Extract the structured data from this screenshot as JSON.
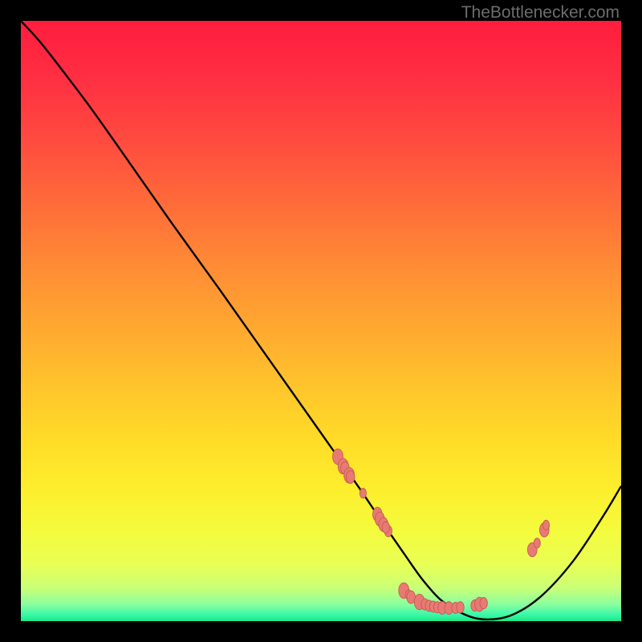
{
  "watermark": "TheBottlenecker.com",
  "gradient_stops": [
    {
      "offset": 0.0,
      "color": "#ff1d3e"
    },
    {
      "offset": 0.1,
      "color": "#ff3042"
    },
    {
      "offset": 0.2,
      "color": "#ff4b3f"
    },
    {
      "offset": 0.3,
      "color": "#ff6a3a"
    },
    {
      "offset": 0.4,
      "color": "#ff8935"
    },
    {
      "offset": 0.5,
      "color": "#ffa531"
    },
    {
      "offset": 0.6,
      "color": "#ffc22c"
    },
    {
      "offset": 0.7,
      "color": "#ffdc28"
    },
    {
      "offset": 0.78,
      "color": "#fdee2c"
    },
    {
      "offset": 0.85,
      "color": "#f4fb3d"
    },
    {
      "offset": 0.905,
      "color": "#e9ff54"
    },
    {
      "offset": 0.945,
      "color": "#c9ff77"
    },
    {
      "offset": 0.972,
      "color": "#8bff9f"
    },
    {
      "offset": 0.99,
      "color": "#37f7a8"
    },
    {
      "offset": 1.0,
      "color": "#1be784"
    }
  ],
  "marker_fill": "#e77b73",
  "marker_stroke": "#c85a52",
  "chart_data": {
    "type": "line",
    "title": "",
    "xlabel": "",
    "ylabel": "",
    "xlim": [
      0,
      100
    ],
    "ylim": [
      0,
      100
    ],
    "series": [
      {
        "name": "bottleneck-curve",
        "x": [
          0.0,
          3.2,
          7.5,
          12.0,
          18.0,
          25.0,
          33.0,
          40.0,
          46.0,
          52.0,
          56.5,
          60.0,
          64.0,
          67.0,
          70.0,
          73.5,
          77.0,
          81.5,
          86.5,
          92.0,
          97.0,
          100.0
        ],
        "y": [
          100.0,
          96.5,
          91.0,
          85.0,
          76.5,
          66.5,
          55.4,
          45.5,
          37.0,
          28.5,
          22.0,
          16.8,
          11.0,
          6.8,
          3.5,
          1.3,
          0.3,
          0.9,
          4.0,
          10.0,
          17.5,
          22.5
        ]
      }
    ],
    "markers": [
      {
        "x": 52.8,
        "y": 27.4,
        "r": 1.1
      },
      {
        "x": 53.7,
        "y": 25.8,
        "r": 1.1
      },
      {
        "x": 54.0,
        "y": 25.5,
        "r": 0.9
      },
      {
        "x": 54.7,
        "y": 24.3,
        "r": 1.1
      },
      {
        "x": 54.9,
        "y": 24.0,
        "r": 0.9
      },
      {
        "x": 57.0,
        "y": 21.3,
        "r": 0.7
      },
      {
        "x": 59.4,
        "y": 17.8,
        "r": 1.0
      },
      {
        "x": 59.8,
        "y": 17.0,
        "r": 1.0
      },
      {
        "x": 60.4,
        "y": 16.1,
        "r": 1.0
      },
      {
        "x": 61.2,
        "y": 15.0,
        "r": 0.8
      },
      {
        "x": 60.8,
        "y": 15.6,
        "r": 0.8
      },
      {
        "x": 63.8,
        "y": 5.1,
        "r": 1.1
      },
      {
        "x": 64.6,
        "y": 4.4,
        "r": 0.7
      },
      {
        "x": 65.0,
        "y": 4.0,
        "r": 0.9
      },
      {
        "x": 66.4,
        "y": 3.2,
        "r": 1.1
      },
      {
        "x": 67.3,
        "y": 2.8,
        "r": 0.8
      },
      {
        "x": 68.0,
        "y": 2.55,
        "r": 0.8
      },
      {
        "x": 68.7,
        "y": 2.4,
        "r": 0.8
      },
      {
        "x": 69.4,
        "y": 2.3,
        "r": 0.8
      },
      {
        "x": 70.2,
        "y": 2.2,
        "r": 0.9
      },
      {
        "x": 71.3,
        "y": 2.18,
        "r": 0.9
      },
      {
        "x": 72.4,
        "y": 2.2,
        "r": 0.8
      },
      {
        "x": 73.2,
        "y": 2.3,
        "r": 0.8
      },
      {
        "x": 75.6,
        "y": 2.6,
        "r": 0.8
      },
      {
        "x": 76.4,
        "y": 2.8,
        "r": 1.0
      },
      {
        "x": 77.1,
        "y": 3.0,
        "r": 0.8
      },
      {
        "x": 85.2,
        "y": 11.9,
        "r": 1.0
      },
      {
        "x": 86.0,
        "y": 13.0,
        "r": 0.7
      },
      {
        "x": 87.2,
        "y": 15.2,
        "r": 1.0
      },
      {
        "x": 87.5,
        "y": 16.0,
        "r": 0.7
      }
    ]
  }
}
